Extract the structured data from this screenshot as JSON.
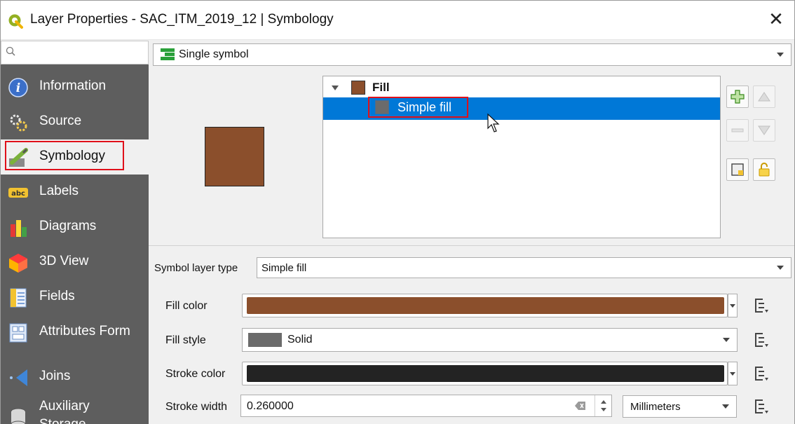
{
  "window": {
    "title": "Layer Properties - SAC_ITM_2019_12 | Symbology",
    "close_glyph": "✕"
  },
  "sidebar": {
    "search_placeholder": "",
    "items": [
      {
        "label": "Information",
        "icon": "information-icon"
      },
      {
        "label": "Source",
        "icon": "source-icon"
      },
      {
        "label": "Symbology",
        "icon": "symbology-icon",
        "active": true
      },
      {
        "label": "Labels",
        "icon": "labels-icon"
      },
      {
        "label": "Diagrams",
        "icon": "diagrams-icon"
      },
      {
        "label": "3D View",
        "icon": "3d-view-icon"
      },
      {
        "label": "Fields",
        "icon": "fields-icon"
      },
      {
        "label": "Attributes Form",
        "icon": "attributes-form-icon"
      },
      {
        "label": "Joins",
        "icon": "joins-icon"
      },
      {
        "label": "Auxiliary\nStorage",
        "icon": "auxiliary-storage-icon"
      }
    ]
  },
  "renderer": {
    "selected": "Single symbol"
  },
  "symbol_tree": {
    "root_label": "Fill",
    "child_label": "Simple fill"
  },
  "symbol_layer_type": {
    "label": "Symbol layer type",
    "value": "Simple fill"
  },
  "properties": {
    "fill_color": {
      "label": "Fill color",
      "value_color": "#8b4f2c"
    },
    "fill_style": {
      "label": "Fill style",
      "value": "Solid"
    },
    "stroke_color": {
      "label": "Stroke color",
      "value_color": "#232323"
    },
    "stroke_width": {
      "label": "Stroke width",
      "value": "0.260000",
      "unit": "Millimeters"
    }
  },
  "colors": {
    "accent_selection": "#0078d7",
    "highlight_box": "#e0101a",
    "sidebar_bg": "#5e5e5e"
  }
}
